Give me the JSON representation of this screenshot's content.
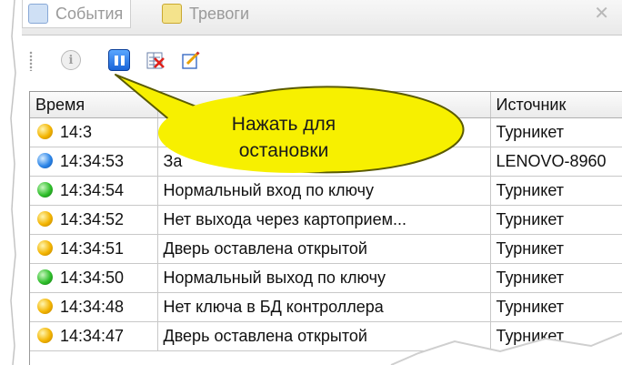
{
  "tabs": [
    {
      "label": "События",
      "icon": "events-icon",
      "active": true
    },
    {
      "label": "Тревоги",
      "icon": "alarm-icon",
      "active": false
    }
  ],
  "toolbar": {
    "buttons": [
      {
        "icon": "info-icon"
      },
      {
        "icon": "pause-icon"
      },
      {
        "icon": "clear-list-icon"
      },
      {
        "icon": "edit-icon"
      }
    ]
  },
  "callout": {
    "text_line1": "Нажать для",
    "text_line2": "остановки"
  },
  "table": {
    "columns": [
      "Время",
      "",
      "Источник"
    ],
    "rows": [
      {
        "status": "yellow",
        "time": "14:3",
        "event": "",
        "source": "Турникет"
      },
      {
        "status": "blue",
        "time": "14:34:53",
        "event": "За",
        "source": "LENOVO-8960"
      },
      {
        "status": "green",
        "time": "14:34:54",
        "event": "Нормальный вход по ключу",
        "source": "Турникет"
      },
      {
        "status": "yellow",
        "time": "14:34:52",
        "event": "Нет выхода через картоприем...",
        "source": "Турникет"
      },
      {
        "status": "yellow",
        "time": "14:34:51",
        "event": "Дверь оставлена открытой",
        "source": "Турникет"
      },
      {
        "status": "green",
        "time": "14:34:50",
        "event": "Нормальный выход по ключу",
        "source": "Турникет"
      },
      {
        "status": "yellow",
        "time": "14:34:48",
        "event": "Нет ключа в БД контроллера",
        "source": "Турникет"
      },
      {
        "status": "yellow",
        "time": "14:34:47",
        "event": "Дверь оставлена открытой",
        "source": "Турникет"
      }
    ]
  },
  "colors": {
    "accent": "#1a64d8",
    "callout_fill": "#f7f000"
  }
}
